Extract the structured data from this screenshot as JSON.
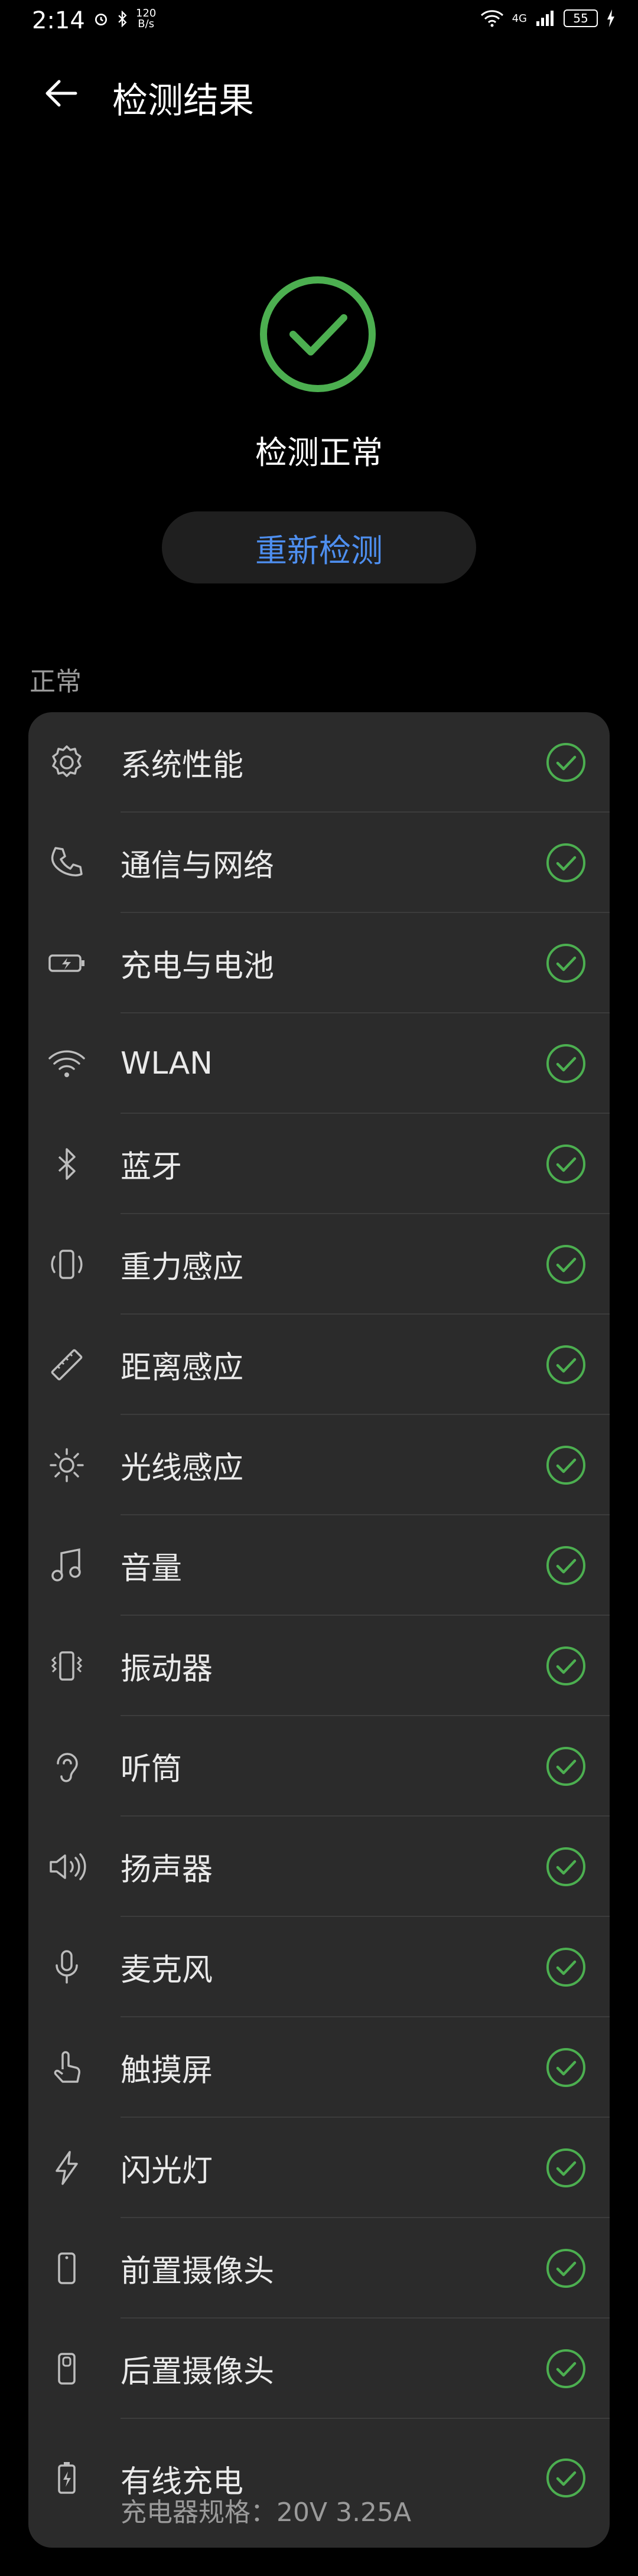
{
  "status_bar": {
    "time": "2:14",
    "speed_value": "120",
    "speed_unit": "B/s",
    "network": "4G",
    "battery": "55"
  },
  "header": {
    "title": "检测结果"
  },
  "result": {
    "status_text": "检测正常",
    "redetect_label": "重新检测"
  },
  "section": {
    "label": "正常"
  },
  "items": [
    {
      "label": "系统性能",
      "icon": "gear-icon"
    },
    {
      "label": "通信与网络",
      "icon": "phone-icon"
    },
    {
      "label": "充电与电池",
      "icon": "battery-charging-icon"
    },
    {
      "label": "WLAN",
      "icon": "wifi-icon"
    },
    {
      "label": "蓝牙",
      "icon": "bluetooth-icon"
    },
    {
      "label": "重力感应",
      "icon": "rotate-phone-icon"
    },
    {
      "label": "距离感应",
      "icon": "ruler-icon"
    },
    {
      "label": "光线感应",
      "icon": "sun-icon"
    },
    {
      "label": "音量",
      "icon": "music-note-icon"
    },
    {
      "label": "振动器",
      "icon": "vibrate-icon"
    },
    {
      "label": "听筒",
      "icon": "ear-icon"
    },
    {
      "label": "扬声器",
      "icon": "speaker-icon"
    },
    {
      "label": "麦克风",
      "icon": "microphone-icon"
    },
    {
      "label": "触摸屏",
      "icon": "touch-icon"
    },
    {
      "label": "闪光灯",
      "icon": "flash-icon"
    },
    {
      "label": "前置摄像头",
      "icon": "front-camera-icon"
    },
    {
      "label": "后置摄像头",
      "icon": "rear-camera-icon"
    },
    {
      "label": "有线充电",
      "sub": "充电器规格：20V 3.25A",
      "icon": "wired-charging-icon"
    }
  ],
  "colors": {
    "accent": "#4e8ff0",
    "ok": "#4caf50",
    "card": "#2b2b2b"
  }
}
